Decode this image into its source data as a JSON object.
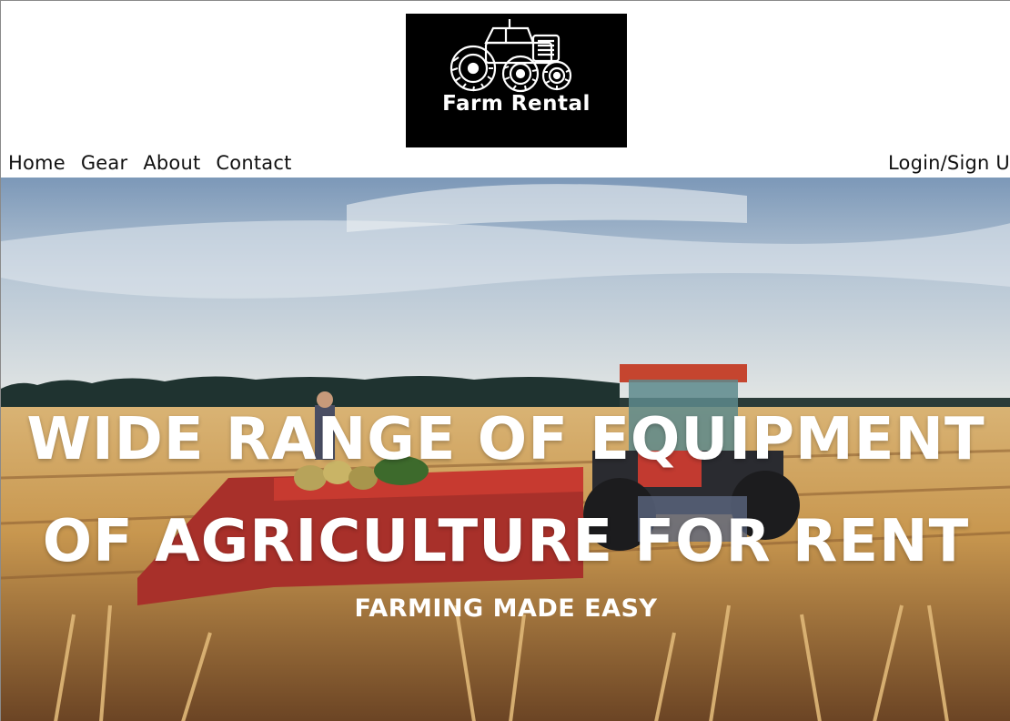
{
  "logo": {
    "text": "Farm Rental",
    "icon": "tractor-icon"
  },
  "nav": {
    "items": [
      {
        "label": "Home"
      },
      {
        "label": "Gear"
      },
      {
        "label": "About"
      },
      {
        "label": "Contact"
      }
    ],
    "login_label": "Login/Sign Up"
  },
  "hero": {
    "title_line1": "WIDE RANGE OF EQUIPMENT",
    "title_line2": "OF AGRICULTURE FOR RENT",
    "subtitle": "FARMING MADE EASY"
  },
  "colors": {
    "header_bg": "#ffffff",
    "logo_bg": "#000000",
    "hero_text": "#ffffff",
    "sky_top": "#6f8fb2",
    "field": "#c89a52"
  }
}
